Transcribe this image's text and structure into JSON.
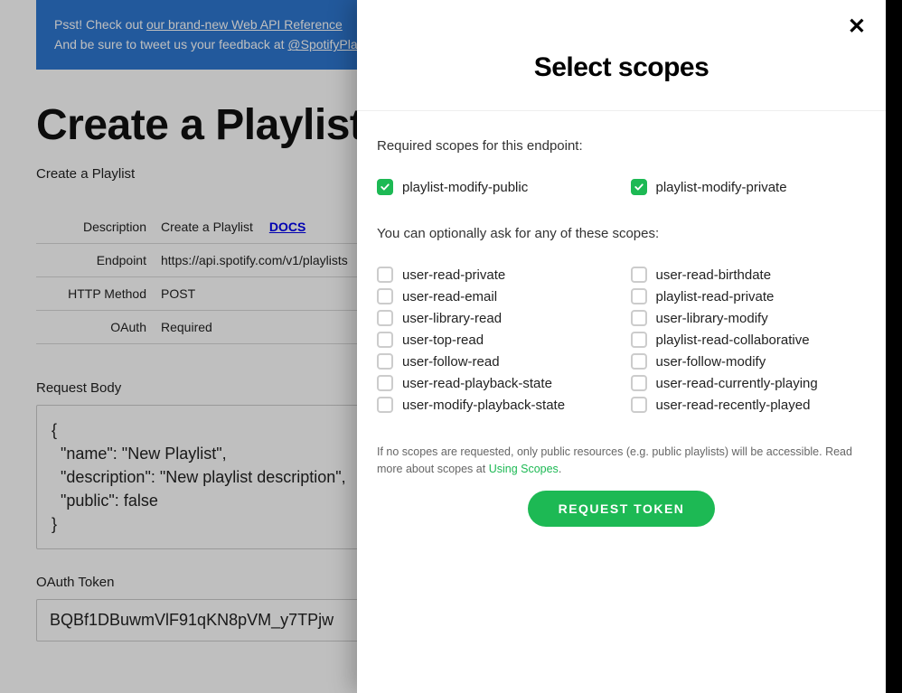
{
  "banner": {
    "line1_prefix": "Psst! Check out ",
    "line1_link": "our brand-new Web API Reference",
    "line2_prefix": "And be sure to tweet us your feedback at ",
    "line2_link": "@SpotifyPla"
  },
  "page": {
    "title": "Create a Playlist",
    "subtitle": "Create a Playlist",
    "meta": {
      "description_label": "Description",
      "description_value": "Create a Playlist",
      "docs_label": "DOCS",
      "endpoint_label": "Endpoint",
      "endpoint_value": "https://api.spotify.com/v1/playlists",
      "method_label": "HTTP Method",
      "method_value": "POST",
      "oauth_label": "OAuth",
      "oauth_value": "Required"
    },
    "request_body_label": "Request Body",
    "request_body_value": "{\n  \"name\": \"New Playlist\",\n  \"description\": \"New playlist description\",\n  \"public\": false\n}",
    "oauth_token_label": "OAuth Token",
    "oauth_token_value": "BQBf1DBuwmVlF91qKN8pVM_y7TPjw"
  },
  "modal": {
    "title": "Select scopes",
    "required_text": "Required scopes for this endpoint:",
    "optional_text": "You can optionally ask for any of these scopes:",
    "required_scopes": [
      {
        "label": "playlist-modify-public",
        "checked": true
      },
      {
        "label": "playlist-modify-private",
        "checked": true
      }
    ],
    "optional_scopes_left": [
      {
        "label": "user-read-private",
        "checked": false
      },
      {
        "label": "user-read-email",
        "checked": false
      },
      {
        "label": "user-library-read",
        "checked": false
      },
      {
        "label": "user-top-read",
        "checked": false
      },
      {
        "label": "user-follow-read",
        "checked": false
      },
      {
        "label": "user-read-playback-state",
        "checked": false
      },
      {
        "label": "user-modify-playback-state",
        "checked": false
      }
    ],
    "optional_scopes_right": [
      {
        "label": "user-read-birthdate",
        "checked": false
      },
      {
        "label": "playlist-read-private",
        "checked": false
      },
      {
        "label": "user-library-modify",
        "checked": false
      },
      {
        "label": "playlist-read-collaborative",
        "checked": false
      },
      {
        "label": "user-follow-modify",
        "checked": false
      },
      {
        "label": "user-read-currently-playing",
        "checked": false
      },
      {
        "label": "user-read-recently-played",
        "checked": false
      }
    ],
    "fineprint_prefix": "If no scopes are requested, only public resources (e.g. public playlists) will be accessible. Read more about scopes at ",
    "fineprint_link": "Using Scopes",
    "fineprint_suffix": ".",
    "request_button": "REQUEST TOKEN"
  }
}
